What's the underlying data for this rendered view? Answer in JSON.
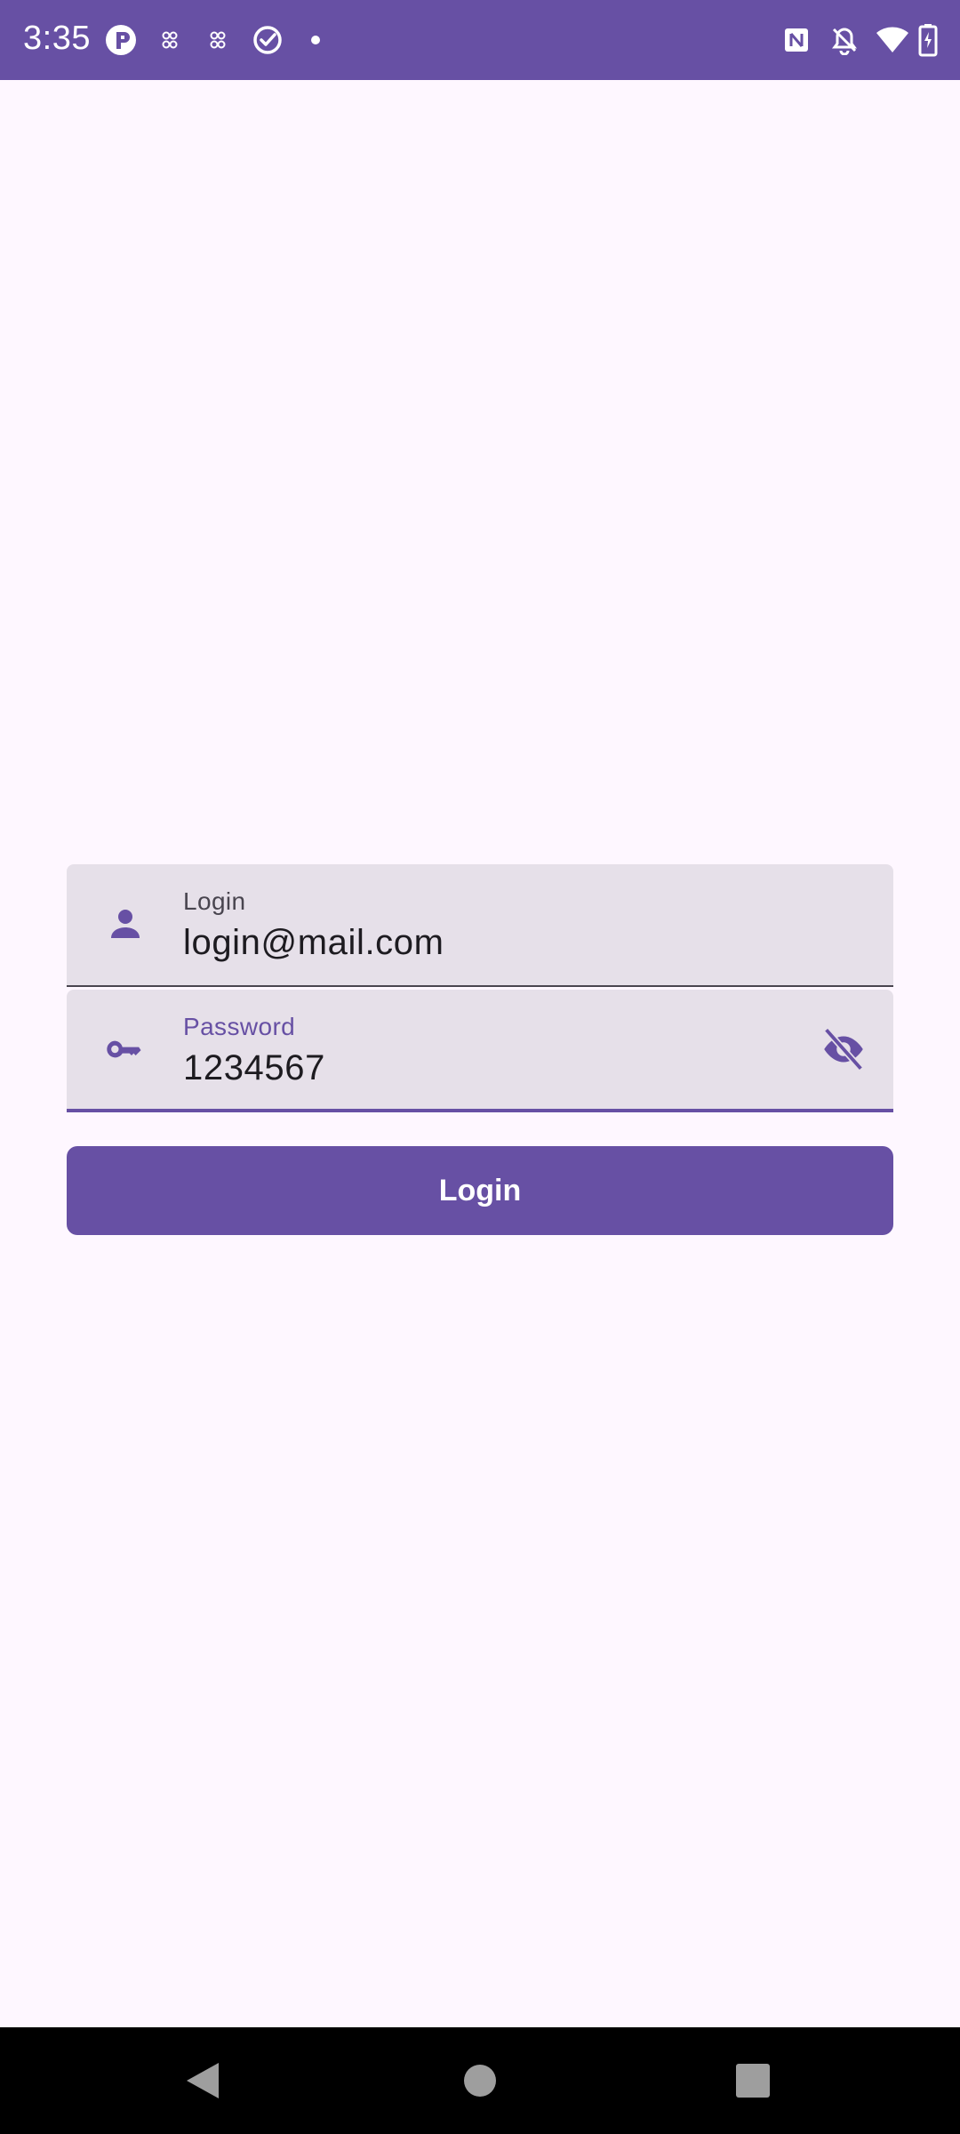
{
  "status_bar": {
    "time": "3:35",
    "left_icons": [
      "app-p-icon",
      "connected-device-icon",
      "connected-device-icon",
      "check-circle-icon",
      "dot-icon"
    ],
    "right_icons": [
      "nfc-icon",
      "bell-off-icon",
      "wifi-icon",
      "battery-charging-icon"
    ]
  },
  "form": {
    "login": {
      "label": "Login",
      "value": "login@mail.com",
      "icon": "person-icon"
    },
    "password": {
      "label": "Password",
      "value": "1234567",
      "icon": "key-icon",
      "toggle_icon": "visibility-off-icon"
    },
    "submit_label": "Login"
  },
  "nav_bar": {
    "buttons": [
      "back-icon",
      "home-icon",
      "recents-icon"
    ]
  },
  "colors": {
    "primary": "#6750A4",
    "surface": "#FEF7FF",
    "field_bg": "#E6E0E9",
    "on_surface": "#1D1B20"
  }
}
